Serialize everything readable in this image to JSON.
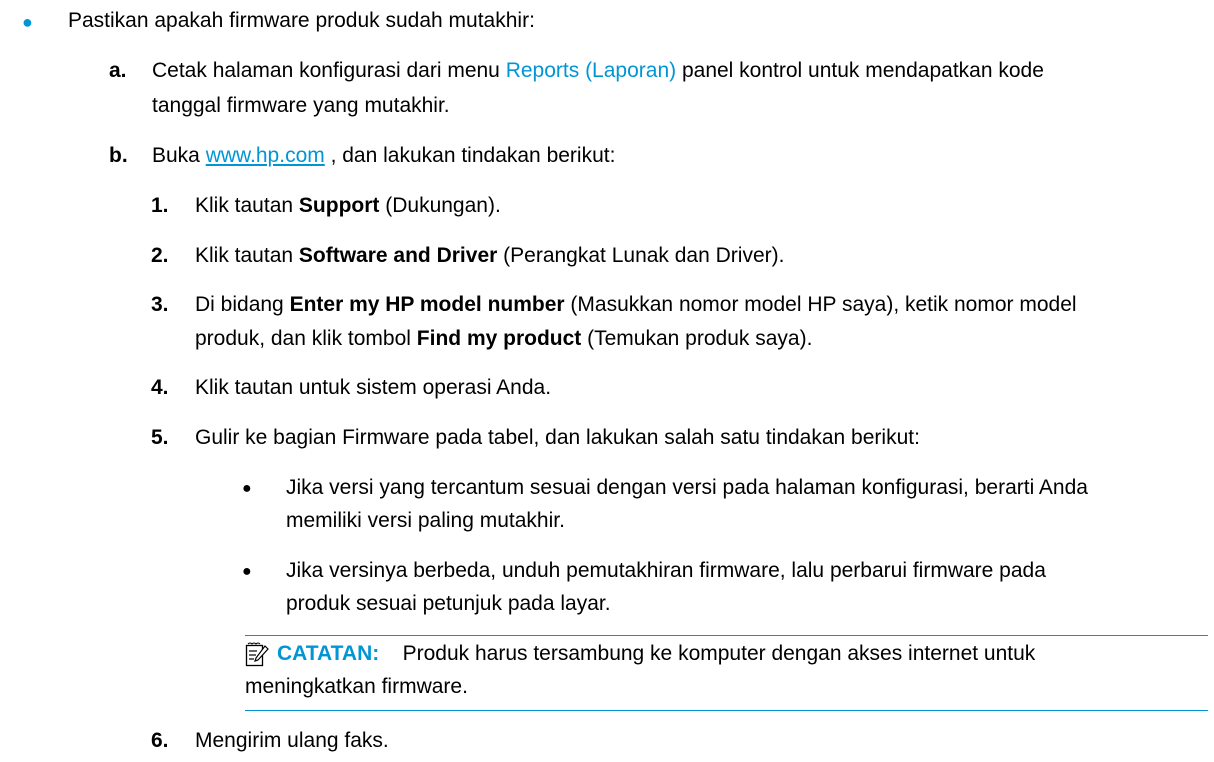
{
  "intro": "Pastikan apakah firmware produk sudah mutakhir:",
  "step_a": {
    "marker": "a.",
    "pre": "Cetak halaman konfigurasi dari menu ",
    "link": "Reports (Laporan)",
    "post": " panel kontrol untuk mendapatkan kode",
    "line2": "tanggal firmware yang mutakhir."
  },
  "step_b": {
    "marker": "b.",
    "pre": "Buka ",
    "link": "www.hp.com",
    "post": " , dan lakukan tindakan berikut:"
  },
  "steps": {
    "s1": {
      "num": "1.",
      "pre": "Klik tautan ",
      "bold": "Support",
      "post": " (Dukungan)."
    },
    "s2": {
      "num": "2.",
      "pre": "Klik tautan ",
      "bold": "Software and Driver",
      "post": " (Perangkat Lunak dan Driver)."
    },
    "s3": {
      "num": "3.",
      "pre": "Di bidang ",
      "bold": "Enter my HP model number",
      "post": " (Masukkan nomor model HP saya), ketik nomor model",
      "l2pre": "produk, dan klik tombol ",
      "l2bold": "Find my product",
      "l2post": " (Temukan produk saya)."
    },
    "s4": {
      "num": "4.",
      "text": "Klik tautan untuk sistem operasi Anda."
    },
    "s5": {
      "num": "5.",
      "text": "Gulir ke bagian Firmware pada tabel, dan lakukan salah satu tindakan berikut:"
    },
    "s6": {
      "num": "6.",
      "text": "Mengirim ulang faks."
    }
  },
  "sub_bullets": [
    {
      "line1": "Jika versi yang tercantum sesuai dengan versi pada halaman konfigurasi, berarti Anda",
      "line2": "memiliki versi paling mutakhir."
    },
    {
      "line1": "Jika versinya berbeda, unduh pemutakhiran firmware, lalu perbarui firmware pada",
      "line2": "produk sesuai petunjuk pada layar."
    }
  ],
  "note": {
    "label": "CATATAN:",
    "line1": "Produk harus tersambung ke komputer dengan akses internet untuk",
    "line2": "meningkatkan firmware."
  },
  "colors": {
    "accent": "#0096d6",
    "text": "#000000"
  },
  "icons": {
    "note": "note-pencil-icon",
    "bullet": "blue-dot-bullet"
  }
}
